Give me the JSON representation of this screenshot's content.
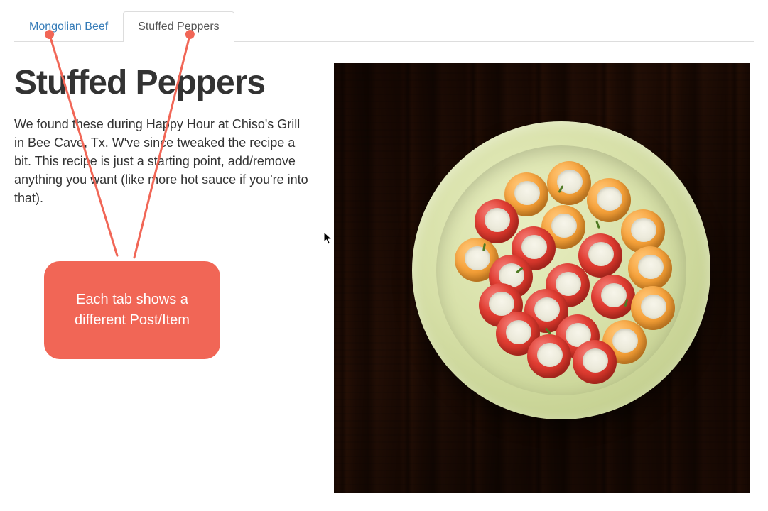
{
  "tabs": [
    {
      "label": "Mongolian Beef",
      "active": false
    },
    {
      "label": "Stuffed Peppers",
      "active": true
    }
  ],
  "page": {
    "title": "Stuffed Peppers",
    "description": "We found these during Happy Hour at Chiso's Grill in Bee Cave, Tx. W've since tweaked the recipe a bit. This recipe is just a starting point, add/remove anything you want (like more hot sauce if you're into that)."
  },
  "annotation": {
    "text": "Each tab shows a different Post/Item"
  },
  "colors": {
    "link": "#337ab7",
    "annotation": "#f16656"
  }
}
